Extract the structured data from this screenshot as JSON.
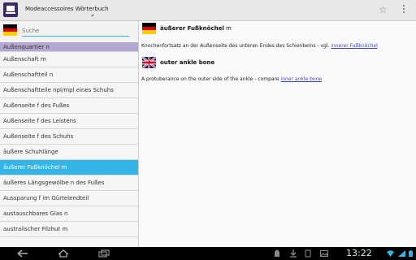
{
  "app": {
    "title": "Modeaccessoires Wörterbuch"
  },
  "colors": {
    "accent": "#33b5e5",
    "lavender": "#b4a7d2",
    "link": "#3a47c8"
  },
  "search": {
    "placeholder": "Suche",
    "flag_icon": "german-flag-icon"
  },
  "list": {
    "items": [
      {
        "label": "Außenquartier n"
      },
      {
        "label": "Außenschaft m"
      },
      {
        "label": "Außenschaftteil n"
      },
      {
        "label": "Außenschaftteile npl/mpl eines Schuhs"
      },
      {
        "label": "Außenseite f des Fußes"
      },
      {
        "label": "Außenseite f des Leistens"
      },
      {
        "label": "Außenseite f des Schuhs"
      },
      {
        "label": "äußere Schuhlänge"
      },
      {
        "label": "äußerer Fußknöchel m"
      },
      {
        "label": "äußeres Längsgewölbe n des Fußes"
      },
      {
        "label": "Aussparung f im Gürtelendteil"
      },
      {
        "label": "austauschbares Glas n"
      },
      {
        "label": "australischer Filzhut m"
      }
    ]
  },
  "detail": {
    "de": {
      "headword": "äußerer Fußknöchel",
      "gender": "m",
      "definition": "Knochenfortsatz an der Außenseite des unteren Endes des Schienbeins - vgl.",
      "link": "innerer Fußknöchel"
    },
    "en": {
      "headword": "outer ankle bone",
      "definition": "A protuberance on the outer side of the ankle - compare",
      "link": "inner ankle bone"
    }
  },
  "system": {
    "time": "13:22"
  }
}
